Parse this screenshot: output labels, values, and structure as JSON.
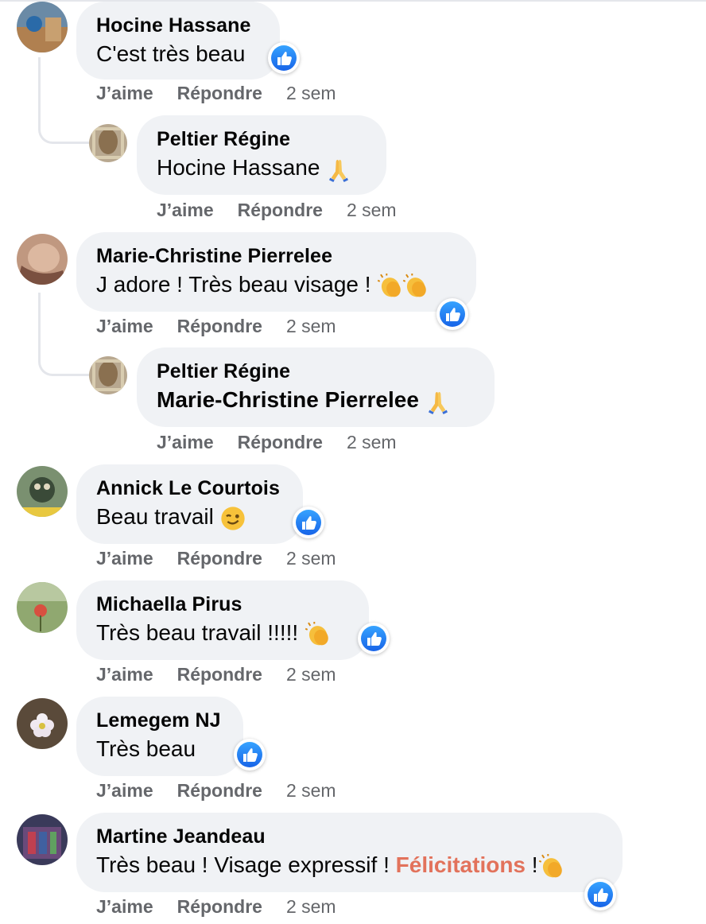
{
  "actions": {
    "like": "J’aime",
    "reply": "Répondre"
  },
  "comments": [
    {
      "name": "Hocine Hassane",
      "text": "C'est très beau",
      "time": "2 sem"
    },
    {
      "name": "Peltier Régine",
      "text": "Hocine Hassane",
      "time": "2 sem"
    },
    {
      "name": "Marie-Christine Pierrelee",
      "text": "J adore ! Très beau visage !",
      "time": "2 sem"
    },
    {
      "name": "Peltier Régine",
      "text": "Marie-Christine Pierrelee",
      "time": "2 sem"
    },
    {
      "name": "Annick Le Courtois",
      "text": "Beau travail",
      "time": "2 sem"
    },
    {
      "name": "Michaella Pirus",
      "text": "Très beau travail !!!!!",
      "time": "2 sem"
    },
    {
      "name": "Lemegem NJ",
      "text": "Très beau",
      "time": "2 sem"
    },
    {
      "name": "Martine Jeandeau",
      "text": "Très beau ! Visage expressif !",
      "text_highlight": "Félicitations",
      "text_suffix": "!",
      "time": "2 sem"
    }
  ],
  "icons": {
    "reaction": "thumbs-up-icon",
    "prayer": "folded-hands-icon",
    "clap": "clapping-hands-icon",
    "wink": "winking-face-icon"
  },
  "colors": {
    "bubble": "#f0f2f5",
    "like_blue": "#1877f2",
    "highlight": "#e2725b",
    "meta": "#65676b"
  }
}
